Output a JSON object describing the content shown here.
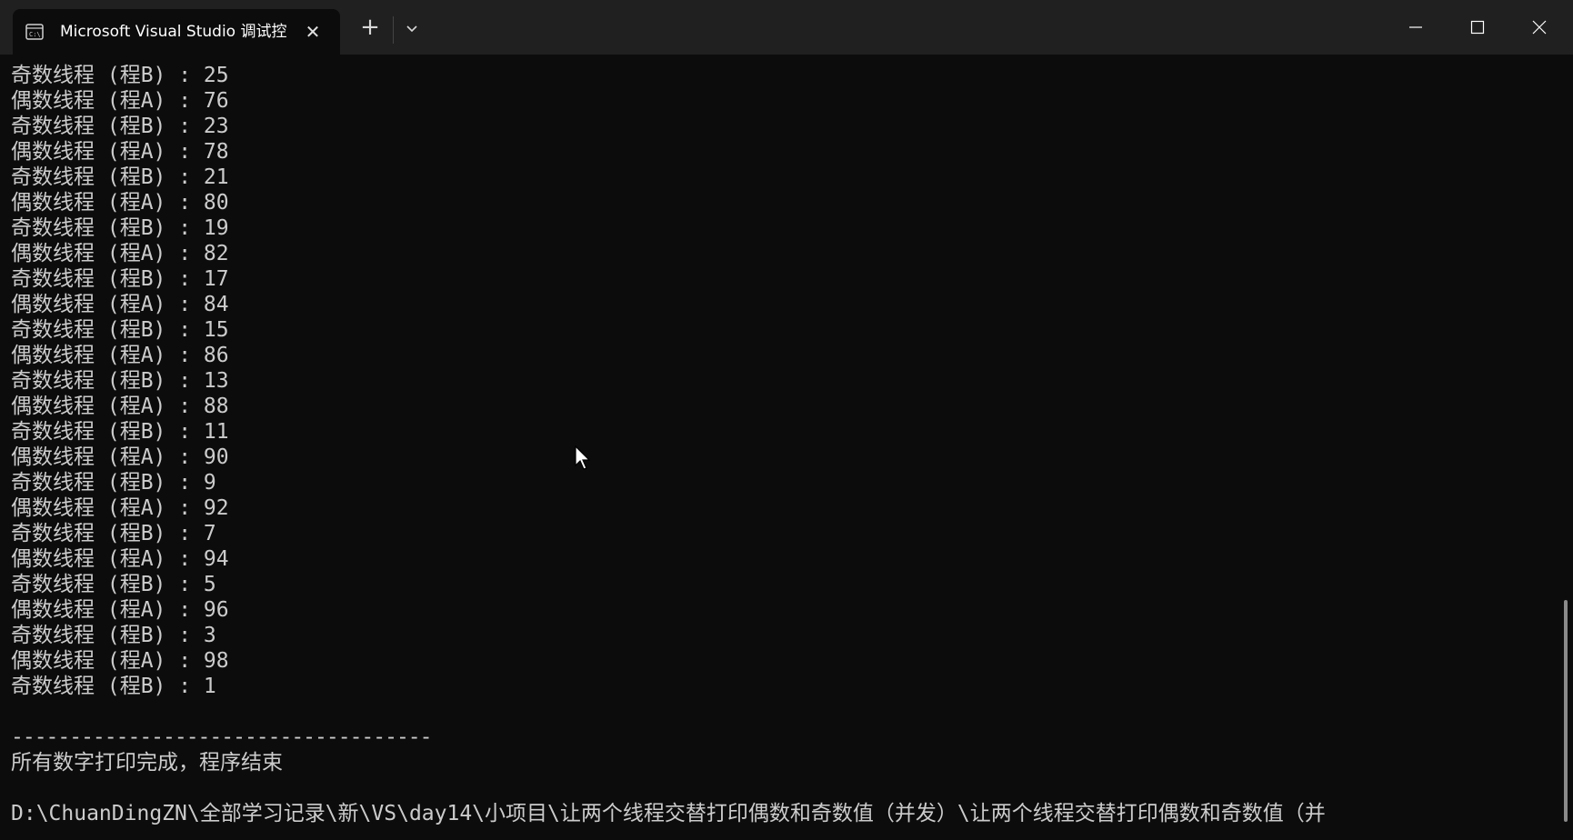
{
  "window": {
    "tab_title": "Microsoft Visual Studio 调试控",
    "tab_icon": "console-icon",
    "close_tab_glyph": "✕",
    "new_tab_glyph": "+",
    "controls": [
      "minimize-icon",
      "maximize-icon",
      "close-icon"
    ]
  },
  "terminal": {
    "lines": [
      "奇数线程 (程B) : 25",
      "偶数线程 (程A) : 76",
      "奇数线程 (程B) : 23",
      "偶数线程 (程A) : 78",
      "奇数线程 (程B) : 21",
      "偶数线程 (程A) : 80",
      "奇数线程 (程B) : 19",
      "偶数线程 (程A) : 82",
      "奇数线程 (程B) : 17",
      "偶数线程 (程A) : 84",
      "奇数线程 (程B) : 15",
      "偶数线程 (程A) : 86",
      "奇数线程 (程B) : 13",
      "偶数线程 (程A) : 88",
      "奇数线程 (程B) : 11",
      "偶数线程 (程A) : 90",
      "奇数线程 (程B) : 9",
      "偶数线程 (程A) : 92",
      "奇数线程 (程B) : 7",
      "偶数线程 (程A) : 94",
      "奇数线程 (程B) : 5",
      "偶数线程 (程A) : 96",
      "奇数线程 (程B) : 3",
      "偶数线程 (程A) : 98",
      "奇数线程 (程B) : 1"
    ],
    "separator": "------------------------------------",
    "finish_message": "所有数字打印完成，程序结束",
    "path_line": "D:\\ChuanDingZN\\全部学习记录\\新\\VS\\day14\\小项目\\让两个线程交替打印偶数和奇数值（并发）\\让两个线程交替打印偶数和奇数值（并"
  },
  "colors": {
    "terminal_bg": "#0c0c0c",
    "titlebar_bg": "#202020",
    "text": "#cccccc"
  }
}
